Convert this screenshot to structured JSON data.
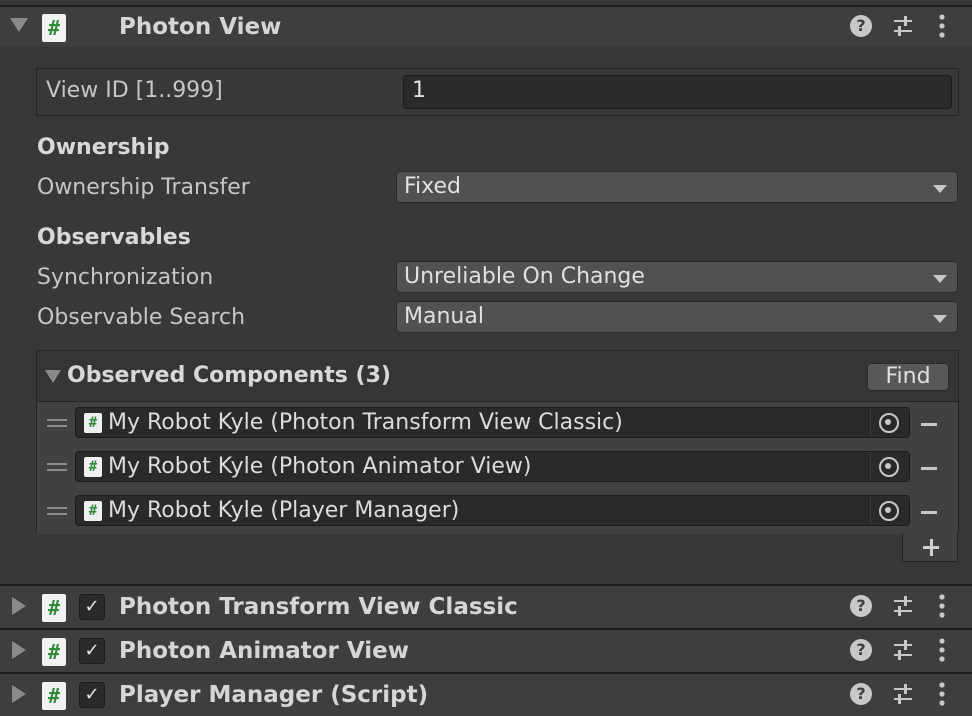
{
  "photon_view": {
    "title": "Photon View",
    "view_id_label": "View ID [1..999]",
    "view_id_value": "1",
    "ownership_heading": "Ownership",
    "ownership_transfer_label": "Ownership Transfer",
    "ownership_transfer_value": "Fixed",
    "observables_heading": "Observables",
    "synchronization_label": "Synchronization",
    "synchronization_value": "Unreliable On Change",
    "observable_search_label": "Observable Search",
    "observable_search_value": "Manual",
    "observed_components_title": "Observed Components (3)",
    "find_label": "Find",
    "observed_components": [
      "My Robot Kyle (Photon Transform View Classic)",
      "My Robot Kyle (Photon Animator View)",
      "My Robot Kyle (Player Manager)"
    ]
  },
  "components": [
    {
      "title": "Photon Transform View Classic",
      "enabled": true
    },
    {
      "title": "Photon Animator View",
      "enabled": true
    },
    {
      "title": "Player Manager (Script)",
      "enabled": true
    }
  ],
  "icons": {
    "script": "script-hash-icon",
    "help": "help-icon",
    "preset": "sliders-icon",
    "menu": "kebab-menu-icon"
  },
  "colors": {
    "background": "#383838",
    "header": "#3e3e3e",
    "script_icon_hash": "#2f8a3a"
  }
}
